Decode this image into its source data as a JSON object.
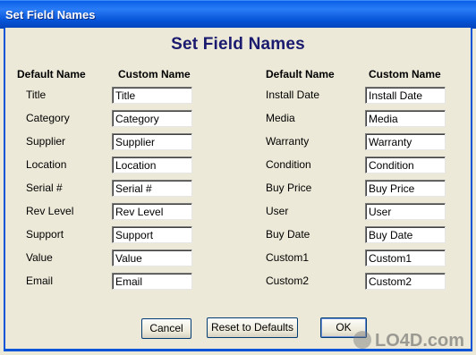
{
  "window": {
    "title": "Set Field Names"
  },
  "heading": "Set Field Names",
  "left": {
    "default_header": "Default Name",
    "custom_header": "Custom Name",
    "rows": [
      {
        "default": "Title",
        "custom": "Title"
      },
      {
        "default": "Category",
        "custom": "Category"
      },
      {
        "default": "Supplier",
        "custom": "Supplier"
      },
      {
        "default": "Location",
        "custom": "Location"
      },
      {
        "default": "Serial #",
        "custom": "Serial #"
      },
      {
        "default": "Rev Level",
        "custom": "Rev Level"
      },
      {
        "default": "Support",
        "custom": "Support"
      },
      {
        "default": "Value",
        "custom": "Value"
      },
      {
        "default": "Email",
        "custom": "Email"
      }
    ]
  },
  "right": {
    "default_header": "Default Name",
    "custom_header": "Custom Name",
    "rows": [
      {
        "default": "Install Date",
        "custom": "Install Date"
      },
      {
        "default": "Media",
        "custom": "Media"
      },
      {
        "default": "Warranty",
        "custom": "Warranty"
      },
      {
        "default": "Condition",
        "custom": "Condition"
      },
      {
        "default": "Buy Price",
        "custom": "Buy Price"
      },
      {
        "default": "User",
        "custom": "User"
      },
      {
        "default": "Buy Date",
        "custom": "Buy Date"
      },
      {
        "default": "Custom1",
        "custom": "Custom1"
      },
      {
        "default": "Custom2",
        "custom": "Custom2"
      }
    ]
  },
  "buttons": {
    "cancel": "Cancel",
    "reset": "Reset to Defaults",
    "ok": "OK"
  },
  "watermark": "LO4D.com"
}
